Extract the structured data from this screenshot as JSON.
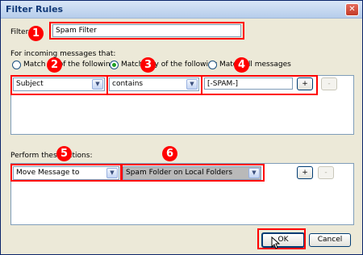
{
  "window": {
    "title": "Filter Rules"
  },
  "filter": {
    "label": "Filter",
    "name_value": "Spam Filter"
  },
  "incoming": {
    "heading": "For incoming messages that:",
    "radio_all_label": "Match all of the following",
    "radio_any_label": "Match any of the following",
    "radio_all_messages_label": "Match all messages",
    "rule_field": "Subject",
    "rule_operator": "contains",
    "rule_value": "[-SPAM-]",
    "add_label": "+",
    "remove_label": "-"
  },
  "actions": {
    "heading": "Perform these actions:",
    "action_type": "Move Message to",
    "action_target": "Spam Folder on Local Folders",
    "add_label": "+",
    "remove_label": "-"
  },
  "footer": {
    "ok_label": "OK",
    "cancel_label": "Cancel"
  },
  "annotations": [
    "1",
    "2",
    "3",
    "4",
    "5",
    "6"
  ],
  "colors": {
    "annotation": "#ff0000",
    "dialog_bg": "#ece9d8",
    "title_text": "#123a78"
  }
}
